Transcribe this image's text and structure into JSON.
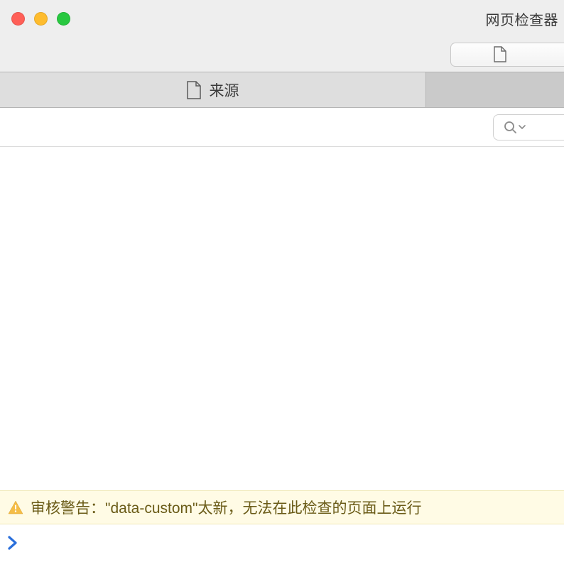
{
  "window": {
    "title": "网页检查器"
  },
  "tabs": {
    "active_label": "来源"
  },
  "warning": {
    "text": "审核警告：\"data-custom\"太新，无法在此检查的页面上运行"
  },
  "colors": {
    "warning_bg": "#fffbe5",
    "warning_fg": "#6a5b17",
    "prompt_blue": "#2a6fdb"
  }
}
